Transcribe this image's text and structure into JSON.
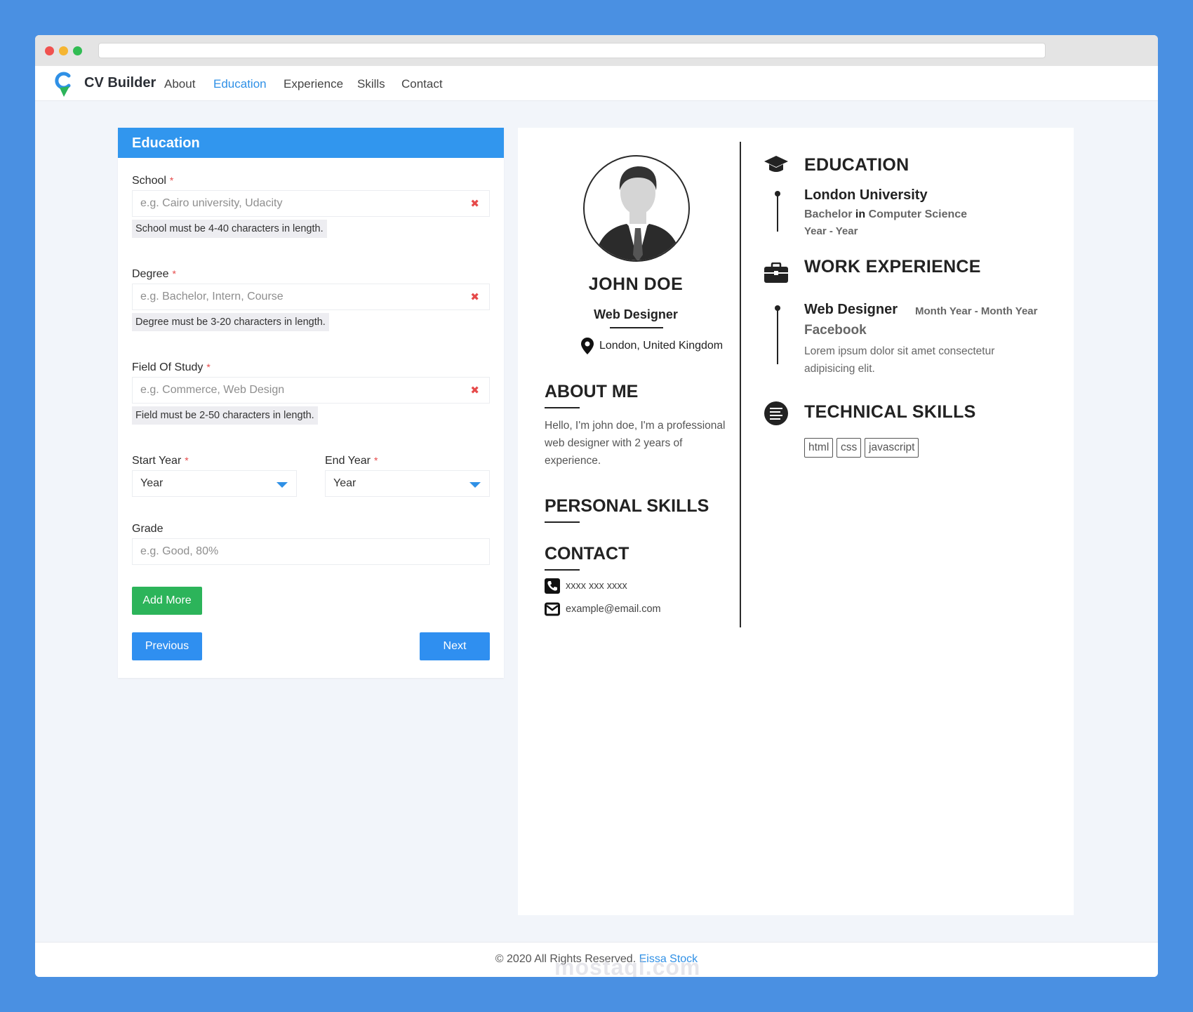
{
  "nav": {
    "brand": "CV Builder",
    "links": [
      "About",
      "Education",
      "Experience",
      "Skills",
      "Contact"
    ],
    "active": "Education"
  },
  "form": {
    "title": "Education",
    "school": {
      "label": "School",
      "placeholder": "e.g. Cairo university, Udacity",
      "hint": "School must be 4-40 characters in length."
    },
    "degree": {
      "label": "Degree",
      "placeholder": "e.g. Bachelor, Intern, Course",
      "hint": "Degree must be 3-20 characters in length."
    },
    "field": {
      "label": "Field Of Study",
      "placeholder": "e.g. Commerce, Web Design",
      "hint": "Field must be 2-50 characters in length."
    },
    "start_year": {
      "label": "Start Year",
      "value": "Year"
    },
    "end_year": {
      "label": "End Year",
      "value": "Year"
    },
    "grade": {
      "label": "Grade",
      "placeholder": "e.g. Good, 80%"
    },
    "required_mark": "*",
    "clear_icon": "✖",
    "add_more": "Add More",
    "previous": "Previous",
    "next": "Next"
  },
  "cv": {
    "name": "JOHN DOE",
    "title": "Web Designer",
    "location": "London, United Kingdom",
    "about_heading": "ABOUT ME",
    "about_text": "Hello, I'm john doe, I'm a professional web designer with 2 years of experience.",
    "personal_skills_heading": "PERSONAL SKILLS",
    "contact_heading": "CONTACT",
    "phone": "xxxx xxx xxxx",
    "email": "example@email.com",
    "education_heading": "EDUCATION",
    "education": {
      "school": "London University",
      "degree": "Bachelor",
      "in": "in",
      "field": "Computer Science",
      "years": "Year - Year"
    },
    "work_heading": "WORK EXPERIENCE",
    "work": {
      "title": "Web Designer",
      "dates": "Month Year - Month Year",
      "company": "Facebook",
      "description": "Lorem ipsum dolor sit amet consectetur adipisicing elit."
    },
    "skills_heading": "TECHNICAL SKILLS",
    "skills": [
      "html",
      "css",
      "javascript"
    ]
  },
  "footer": {
    "copyright": "© 2020 All Rights Reserved.",
    "author": "Eissa Stock"
  },
  "watermark": "mostaql.com",
  "colors": {
    "background": "#4a90e2",
    "accent": "#2f90e6",
    "header": "#3196ee",
    "success": "#2cb45a",
    "error": "#e64a4a"
  }
}
